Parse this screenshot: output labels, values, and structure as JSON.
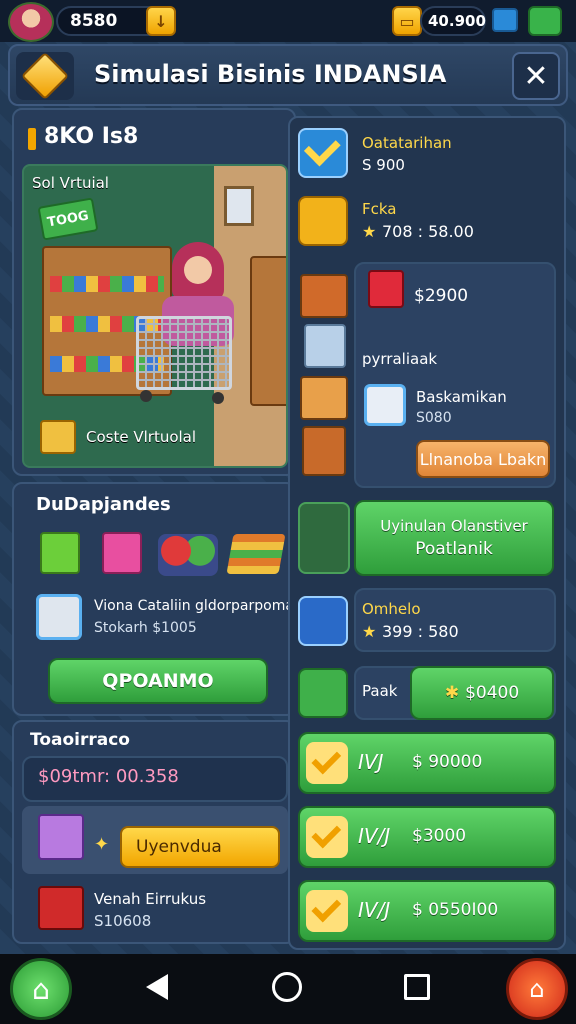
{
  "topbar": {
    "money": "8580",
    "right_value": "40.900"
  },
  "header": {
    "title": "Simulasi Bisinis INDANSIA",
    "close_label": "✕"
  },
  "store_panel": {
    "heading": "8KO Is8",
    "scene_label": "Sol Vrtuial",
    "scene_sign": "TOOG",
    "box_label": "Coste Vlrtuolal"
  },
  "products_panel": {
    "heading": "DuDapjandes",
    "product_name": "Viona Cataliin gldorparpoma",
    "product_price": "Stokarh $1005",
    "button_label": "QPOANMO"
  },
  "transactions_panel": {
    "heading": "Toaoirraco",
    "amount": "$09tmr: 00.358",
    "upgrade_label": "Uyenvdua",
    "item_name": "Venah Eirrukus",
    "item_price": "S10608"
  },
  "right_column": {
    "task1_title": "Oatatarihan",
    "task1_value": "S 900",
    "task2_title": "Fcka",
    "task2_value": "708 : 58.00",
    "gift_price": "$2900",
    "section_label": "pyrraliaak",
    "offer_name": "Baskamikan",
    "offer_price": "S080",
    "offer_button": "Llnanoba Lbakn",
    "promo_line1": "Uyinulan Olanstiver",
    "promo_line2": "Poatlanik",
    "stat_title": "Omhelo",
    "stat_value": "399 : 580",
    "pack_label": "Paak",
    "pack_value": "$0400",
    "rows": [
      {
        "code": "IVJ",
        "value": "$ 90000"
      },
      {
        "code": "IV/J",
        "value": "$3000"
      },
      {
        "code": "IV/J",
        "value": "$ 0550I00"
      }
    ]
  },
  "colors": {
    "accent_gold": "#f2a600",
    "accent_green": "#2f9e3b",
    "panel": "#273c5a"
  }
}
